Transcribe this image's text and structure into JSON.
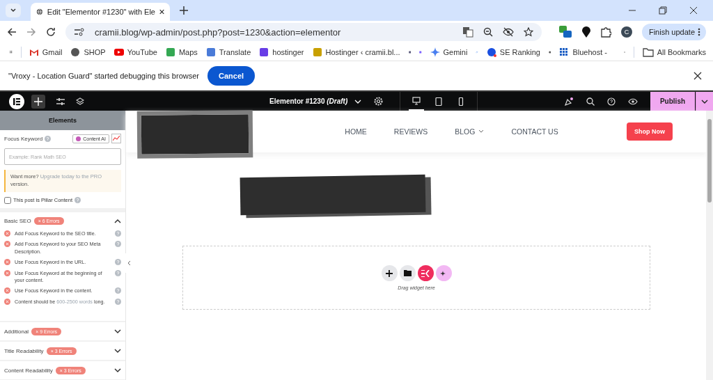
{
  "browser": {
    "tabs": [
      {
        "title": "Edit \"Elementor #1230\" with Ele",
        "selected": true
      }
    ],
    "url": "cramii.blog/wp-admin/post.php?post=1230&action=elementor",
    "profile": "C",
    "finish_update": "Finish update",
    "bookmarks": [
      {
        "kind": "mail",
        "label": "Gmail"
      },
      {
        "kind": "globe",
        "label": "SHOP"
      },
      {
        "kind": "video",
        "label": "YouTube"
      },
      {
        "kind": "map",
        "label": "Maps"
      },
      {
        "kind": "translate",
        "label": "Translate"
      },
      {
        "kind": "grid-h",
        "label": "hostinger"
      },
      {
        "kind": "star",
        "label": "Hostinger ‹ cramii.bl..."
      },
      {
        "kind": "hat"
      },
      {
        "kind": "pen"
      },
      {
        "kind": "sparkle",
        "label": "Gemini"
      },
      {
        "kind": "link"
      },
      {
        "kind": "ring",
        "label": "SE Ranking"
      },
      {
        "kind": "globe"
      },
      {
        "kind": "dots",
        "label": "Bluehost -"
      }
    ],
    "all_bookmarks": "All Bookmarks"
  },
  "infobar": {
    "message": "\"Vroxy - Location Guard\" started debugging this browser",
    "button": "Cancel"
  },
  "editor": {
    "document": "Elementor #1230",
    "status": "(Draft)",
    "devices": [
      {
        "kind": "desktop",
        "selected": true
      },
      {
        "kind": "tablet",
        "selected": false
      },
      {
        "kind": "mobile",
        "selected": false
      }
    ],
    "publish": "Publish"
  },
  "panel": {
    "header": "Elements",
    "focus_label": "Focus Keyword",
    "content_ai": "Content AI",
    "placeholder": "Example: Rank Math SEO",
    "notice": {
      "before": "Want more? ",
      "link": "Upgrade today to the PRO",
      "after": " version."
    },
    "pillar": {
      "label": "This post is Pillar Content",
      "checked": false
    },
    "sections": [
      {
        "title": "Basic SEO",
        "badge": "× 6 Errors",
        "expanded": true,
        "checks": [
          {
            "before": "Add Focus Keyword to the SEO title."
          },
          {
            "before": "Add Focus Keyword to your SEO Meta Description."
          },
          {
            "before": "Use Focus Keyword in the URL."
          },
          {
            "before": "Use Focus Keyword at the beginning of your content."
          },
          {
            "before": "Use Focus Keyword in the content."
          },
          {
            "before": "Content should be ",
            "link": "600-2500 words",
            "after": " long."
          }
        ]
      },
      {
        "title": "Additional",
        "badge": "× 9 Errors",
        "expanded": false
      },
      {
        "title": "Title Readability",
        "badge": "× 3 Errors",
        "expanded": false
      },
      {
        "title": "Content Readability",
        "badge": "× 3 Errors",
        "expanded": false
      }
    ]
  },
  "canvas": {
    "nav": [
      {
        "label": "HOME",
        "dropdown": false
      },
      {
        "label": "REVIEWS",
        "dropdown": false
      },
      {
        "label": "BLOG",
        "dropdown": true
      },
      {
        "label": "CONTACT US",
        "dropdown": false
      }
    ],
    "shop": "Shop Now",
    "drop_hint": "Drag widget here"
  }
}
